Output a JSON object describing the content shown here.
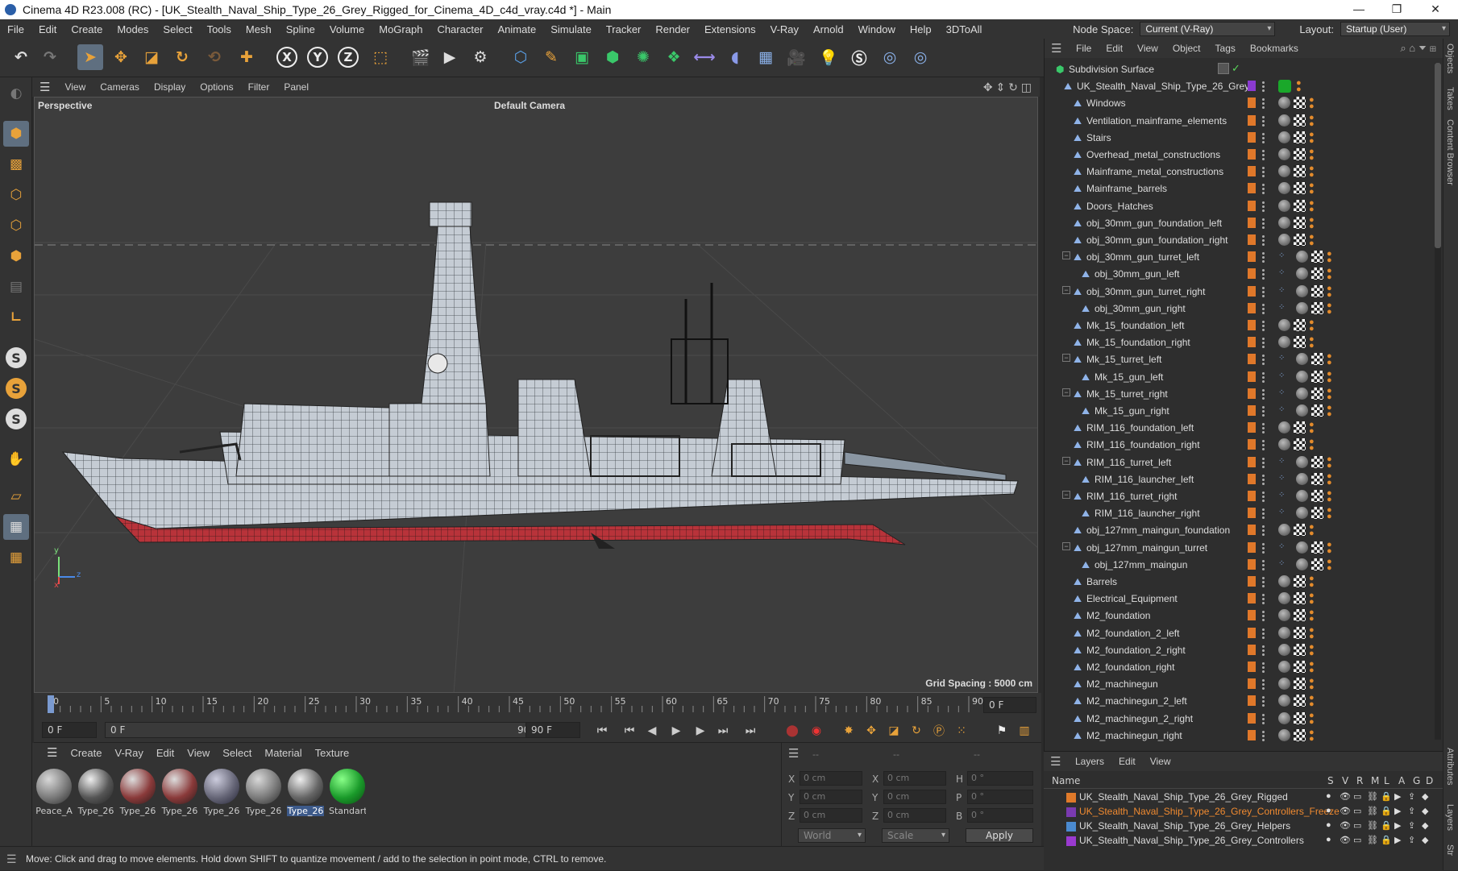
{
  "window": {
    "title": "Cinema 4D R23.008 (RC) - [UK_Stealth_Naval_Ship_Type_26_Grey_Rigged_for_Cinema_4D_c4d_vray.c4d *] - Main",
    "controls": [
      "—",
      "❐",
      "✕"
    ]
  },
  "menu": {
    "items": [
      "File",
      "Edit",
      "Create",
      "Modes",
      "Select",
      "Tools",
      "Mesh",
      "Spline",
      "Volume",
      "MoGraph",
      "Character",
      "Animate",
      "Simulate",
      "Tracker",
      "Render",
      "Extensions",
      "V-Ray",
      "Arnold",
      "Window",
      "Help",
      "3DToAll"
    ],
    "node_space_label": "Node Space:",
    "node_space_value": "Current (V-Ray)",
    "layout_label": "Layout:",
    "layout_value": "Startup (User)"
  },
  "toolbar": {
    "icons": [
      "undo-icon",
      "redo-icon",
      "select-arrow-icon",
      "move-icon",
      "scale-icon",
      "rotate-icon",
      "recent-tool-icon",
      "add-icon",
      "x-axis-icon",
      "y-axis-icon",
      "z-axis-icon",
      "coord-system-icon",
      "render-region-icon",
      "render-view-icon",
      "render-settings-icon",
      "cube-icon",
      "pen-icon",
      "subdivision-icon",
      "extrude-icon",
      "array-icon",
      "mograph-icon",
      "deformer-icon",
      "paint-icon",
      "floor-icon",
      "camera-icon",
      "light-icon",
      "vray-icon",
      "python-icon",
      "python2-icon"
    ],
    "axis_labels": [
      "X",
      "Y",
      "Z"
    ]
  },
  "left_toolbar": {
    "snap_labels": [
      "S",
      "S",
      "S"
    ]
  },
  "viewport": {
    "menu": [
      "View",
      "Cameras",
      "Display",
      "Options",
      "Filter",
      "Panel"
    ],
    "label": "Perspective",
    "camera": "Default Camera",
    "grid_spacing": "Grid Spacing : 5000 cm",
    "axis_labels": [
      "y",
      "z",
      "x"
    ]
  },
  "timeline": {
    "ticks": [
      "0",
      "5",
      "10",
      "15",
      "20",
      "25",
      "30",
      "35",
      "40",
      "45",
      "50",
      "55",
      "60",
      "65",
      "70",
      "75",
      "80",
      "85",
      "90"
    ],
    "current_frame": "0 F",
    "start": "0 F",
    "range_start": "0 F",
    "range_end": "90 F",
    "end": "90 F"
  },
  "materials": {
    "menu": [
      "Create",
      "V-Ray",
      "Edit",
      "View",
      "Select",
      "Material",
      "Texture"
    ],
    "items": [
      "Peace_A",
      "Type_26",
      "Type_26",
      "Type_26",
      "Type_26",
      "Type_26",
      "Type_26",
      "Standart"
    ]
  },
  "attributes": {
    "header": [
      "--",
      "--",
      "--"
    ],
    "rows": [
      {
        "a": "X",
        "av": "0 cm",
        "b": "X",
        "bv": "0 cm",
        "c": "H",
        "cv": "0 °"
      },
      {
        "a": "Y",
        "av": "0 cm",
        "b": "Y",
        "bv": "0 cm",
        "c": "P",
        "cv": "0 °"
      },
      {
        "a": "Z",
        "av": "0 cm",
        "b": "Z",
        "bv": "0 cm",
        "c": "B",
        "cv": "0 °"
      }
    ],
    "world": "World",
    "scale": "Scale",
    "apply": "Apply"
  },
  "status": "Move: Click and drag to move elements. Hold down SHIFT to quantize movement / add to the selection in point mode, CTRL to remove.",
  "objects": {
    "menu": [
      "File",
      "Edit",
      "View",
      "Object",
      "Tags",
      "Bookmarks"
    ],
    "rows": [
      {
        "name": "Subdivision Surface",
        "level": 0,
        "kind": "sub"
      },
      {
        "name": "UK_Stealth_Naval_Ship_Type_26_Grey",
        "level": 1,
        "kind": "root"
      },
      {
        "name": "Windows",
        "level": 2
      },
      {
        "name": "Ventilation_mainframe_elements",
        "level": 2
      },
      {
        "name": "Stairs",
        "level": 2
      },
      {
        "name": "Overhead_metal_constructions",
        "level": 2
      },
      {
        "name": "Mainframe_metal_constructions",
        "level": 2
      },
      {
        "name": "Mainframe_barrels",
        "level": 2
      },
      {
        "name": "Doors_Hatches",
        "level": 2
      },
      {
        "name": "obj_30mm_gun_foundation_left",
        "level": 2
      },
      {
        "name": "obj_30mm_gun_foundation_right",
        "level": 2
      },
      {
        "name": "obj_30mm_gun_turret_left",
        "level": 2,
        "exp": true
      },
      {
        "name": "obj_30mm_gun_left",
        "level": 3
      },
      {
        "name": "obj_30mm_gun_turret_right",
        "level": 2,
        "exp": true
      },
      {
        "name": "obj_30mm_gun_right",
        "level": 3
      },
      {
        "name": "Mk_15_foundation_left",
        "level": 2
      },
      {
        "name": "Mk_15_foundation_right",
        "level": 2
      },
      {
        "name": "Mk_15_turret_left",
        "level": 2,
        "exp": true
      },
      {
        "name": "Mk_15_gun_left",
        "level": 3
      },
      {
        "name": "Mk_15_turret_right",
        "level": 2,
        "exp": true
      },
      {
        "name": "Mk_15_gun_right",
        "level": 3
      },
      {
        "name": "RIM_116_foundation_left",
        "level": 2
      },
      {
        "name": "RIM_116_foundation_right",
        "level": 2
      },
      {
        "name": "RIM_116_turret_left",
        "level": 2,
        "exp": true
      },
      {
        "name": "RIM_116_launcher_left",
        "level": 3
      },
      {
        "name": "RIM_116_turret_right",
        "level": 2,
        "exp": true
      },
      {
        "name": "RIM_116_launcher_right",
        "level": 3
      },
      {
        "name": "obj_127mm_maingun_foundation",
        "level": 2
      },
      {
        "name": "obj_127mm_maingun_turret",
        "level": 2,
        "exp": true
      },
      {
        "name": "obj_127mm_maingun",
        "level": 3
      },
      {
        "name": "Barrels",
        "level": 2
      },
      {
        "name": "Electrical_Equipment",
        "level": 2
      },
      {
        "name": "M2_foundation",
        "level": 2
      },
      {
        "name": "M2_foundation_2_left",
        "level": 2
      },
      {
        "name": "M2_foundation_2_right",
        "level": 2
      },
      {
        "name": "M2_foundation_right",
        "level": 2
      },
      {
        "name": "M2_machinegun",
        "level": 2
      },
      {
        "name": "M2_machinegun_2_left",
        "level": 2
      },
      {
        "name": "M2_machinegun_2_right",
        "level": 2
      },
      {
        "name": "M2_machinegun_right",
        "level": 2
      }
    ]
  },
  "layers": {
    "menu": [
      "Layers",
      "Edit",
      "View"
    ],
    "name_header": "Name",
    "col_headers": [
      "S",
      "V",
      "R",
      "M",
      "L",
      "A",
      "G",
      "D"
    ],
    "rows": [
      {
        "name": "UK_Stealth_Naval_Ship_Type_26_Grey_Rigged",
        "color": "#e07a2a",
        "text": "#dddddd"
      },
      {
        "name": "UK_Stealth_Naval_Ship_Type_26_Grey_Controllers_Freeze",
        "color": "#7a3ab0",
        "text": "#f08a30"
      },
      {
        "name": "UK_Stealth_Naval_Ship_Type_26_Grey_Helpers",
        "color": "#4a8ad0",
        "text": "#dddddd"
      },
      {
        "name": "UK_Stealth_Naval_Ship_Type_26_Grey_Controllers",
        "color": "#9a3ad0",
        "text": "#dddddd"
      }
    ]
  },
  "side_tabs": [
    "Objects",
    "Takes",
    "Content Browser",
    "Attributes",
    "Layers",
    "Str"
  ]
}
